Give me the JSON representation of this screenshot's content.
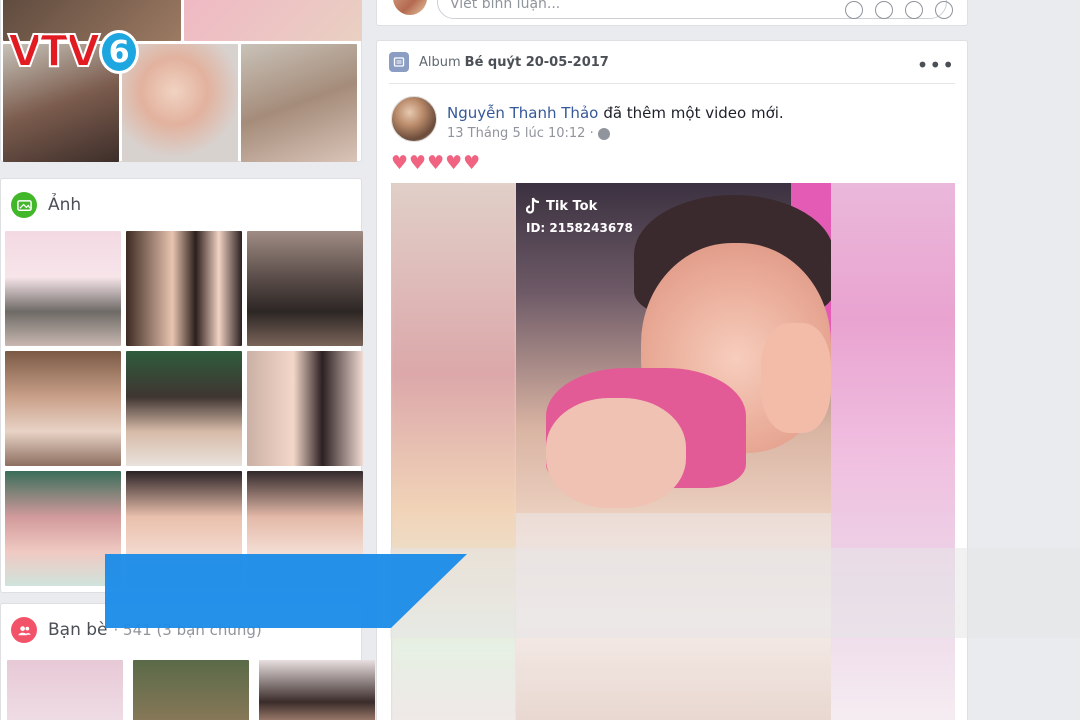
{
  "overlay": {
    "broadcaster_logo": "VTV6"
  },
  "sidebar": {
    "photos": {
      "title": "Ảnh",
      "icon": "image-icon",
      "accent": "#42b72a"
    },
    "friends": {
      "title": "Bạn bè",
      "meta": "· 541 (3 bạn chung)",
      "icon": "friends-icon",
      "accent": "#f35369"
    }
  },
  "composer": {
    "placeholder": "Viết bình luận..."
  },
  "post": {
    "album_prefix": "Album",
    "album_name": "Bé quýt 20-05-2017",
    "author": "Nguyễn Thanh Thảo",
    "action": "đã thêm một video mới.",
    "timestamp": "13 Tháng 5 lúc 10:12 ·",
    "privacy_icon": "globe-icon",
    "message": "♥♥♥♥♥",
    "video": {
      "watermark": "Tik Tok",
      "id_label": "ID: 2158243678"
    }
  },
  "colors": {
    "link": "#365899",
    "heart": "#f06481",
    "banner": "#1a8be8"
  }
}
